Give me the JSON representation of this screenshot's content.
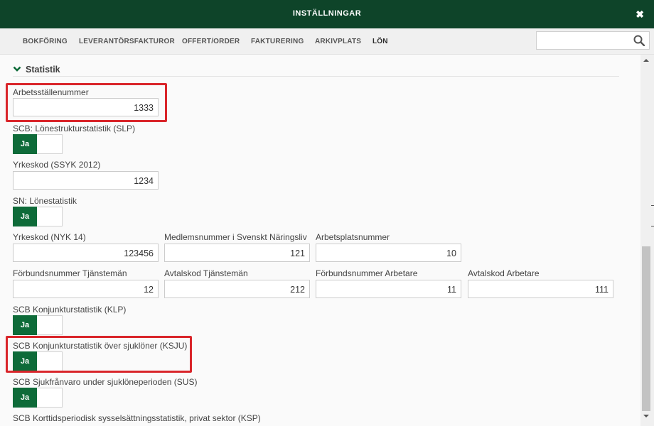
{
  "dialog": {
    "title": "INSTÄLLNINGAR",
    "close_label": "✖"
  },
  "tabs": [
    {
      "label": "BOKFÖRING",
      "active": false
    },
    {
      "label": "LEVERANTÖRSFAKTUROR",
      "active": false
    },
    {
      "label": "OFFERT/ORDER",
      "active": false
    },
    {
      "label": "FAKTURERING",
      "active": false
    },
    {
      "label": "ARKIVPLATS",
      "active": false
    },
    {
      "label": "LÖN",
      "active": true
    }
  ],
  "search": {
    "value": "",
    "placeholder": ""
  },
  "section": {
    "title": "Statistik",
    "expanded": true
  },
  "fields": {
    "arbetsstallenummer": {
      "label": "Arbetsställenummer",
      "value": "1333"
    },
    "slp": {
      "label": "SCB: Lönestrukturstatistik (SLP)",
      "toggle": "Ja"
    },
    "yrkeskod_ssyk": {
      "label": "Yrkeskod (SSYK 2012)",
      "value": "1234"
    },
    "sn_lonestatistik": {
      "label": "SN: Lönestatistik",
      "toggle": "Ja"
    },
    "yrkeskod_nyk": {
      "label": "Yrkeskod (NYK 14)",
      "value": "123456"
    },
    "medlemsnummer": {
      "label": "Medlemsnummer i Svenskt Näringsliv",
      "value": "121"
    },
    "arbetsplatsnummer": {
      "label": "Arbetsplatsnummer",
      "value": "10"
    },
    "forbundsnummer_tjansteman": {
      "label": "Förbundsnummer Tjänstemän",
      "value": "12"
    },
    "avtalskod_tjansteman": {
      "label": "Avtalskod Tjänstemän",
      "value": "212"
    },
    "forbundsnummer_arbetare": {
      "label": "Förbundsnummer Arbetare",
      "value": "11"
    },
    "avtalskod_arbetare": {
      "label": "Avtalskod Arbetare",
      "value": "111"
    },
    "klp": {
      "label": "SCB Konjunkturstatistik (KLP)",
      "toggle": "Ja"
    },
    "ksju": {
      "label": "SCB Konjunkturstatistik över sjuklöner (KSJU)",
      "toggle": "Ja"
    },
    "sus": {
      "label": "SCB Sjukfrånvaro under sjuklöneperioden (SUS)",
      "toggle": "Ja"
    },
    "ksp": {
      "label": "SCB Korttidsperiodisk sysselsättningsstatistik, privat sektor (KSP)"
    }
  },
  "colors": {
    "header_bg": "#0e4429",
    "accent": "#0e6b39",
    "highlight": "#d9252a"
  }
}
